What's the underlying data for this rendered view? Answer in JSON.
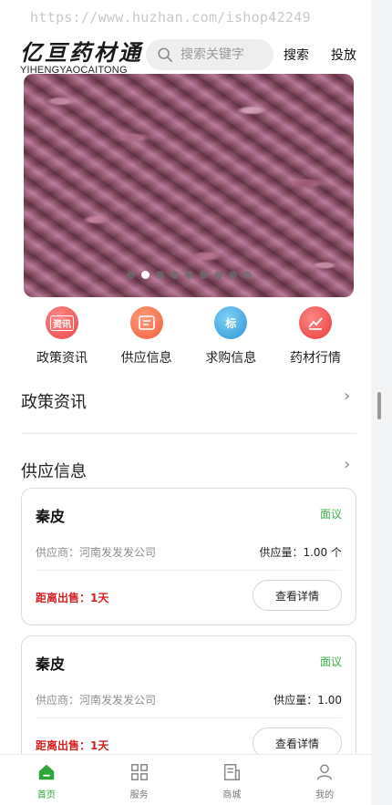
{
  "watermark": "https://www.huzhan.com/ishop42249",
  "logo": {
    "cn": "亿亘药材通",
    "en": "YIHENGYAOCAITONG"
  },
  "search": {
    "placeholder": "搜索关键字",
    "button": "搜索"
  },
  "header": {
    "publish_label": "投放"
  },
  "banner": {
    "slide_count": 9,
    "active_index": 1
  },
  "quick_nav": [
    {
      "icon_text": "资讯",
      "label": "政策资讯",
      "color": "#ee5959",
      "icon": "news-icon"
    },
    {
      "icon_text": "",
      "label": "供应信息",
      "color": "#f26b4b",
      "icon": "supply-icon"
    },
    {
      "icon_text": "标",
      "label": "求购信息",
      "color": "#3aa3e0",
      "icon": "shield-icon"
    },
    {
      "icon_text": "",
      "label": "药材行情",
      "color": "#f04a4a",
      "icon": "market-icon"
    }
  ],
  "sections": {
    "policy": {
      "title": "政策资讯",
      "arrow": "›"
    },
    "supply": {
      "title": "供应信息",
      "arrow": "›"
    }
  },
  "supply_cards": [
    {
      "name": "秦皮",
      "price": "面议",
      "supplier": "供应商：河南发发发公司",
      "qty": "供应量：1.00 个",
      "countdown": "距离出售：1天",
      "button": "查看详情"
    },
    {
      "name": "秦皮",
      "price": "面议",
      "supplier": "供应商：河南发发发公司",
      "qty": "供应量：1.00",
      "countdown": "距离出售：1天",
      "button": "查看详情"
    }
  ],
  "tabbar": [
    {
      "label": "首页",
      "icon": "home-icon",
      "active": true
    },
    {
      "label": "服务",
      "icon": "grid-icon",
      "active": false
    },
    {
      "label": "商城",
      "icon": "shop-icon",
      "active": false
    },
    {
      "label": "我的",
      "icon": "user-icon",
      "active": false
    }
  ],
  "colors": {
    "accent_green": "#2ea43a",
    "price_green": "#3fb14a",
    "countdown_red": "#d61f1f"
  }
}
